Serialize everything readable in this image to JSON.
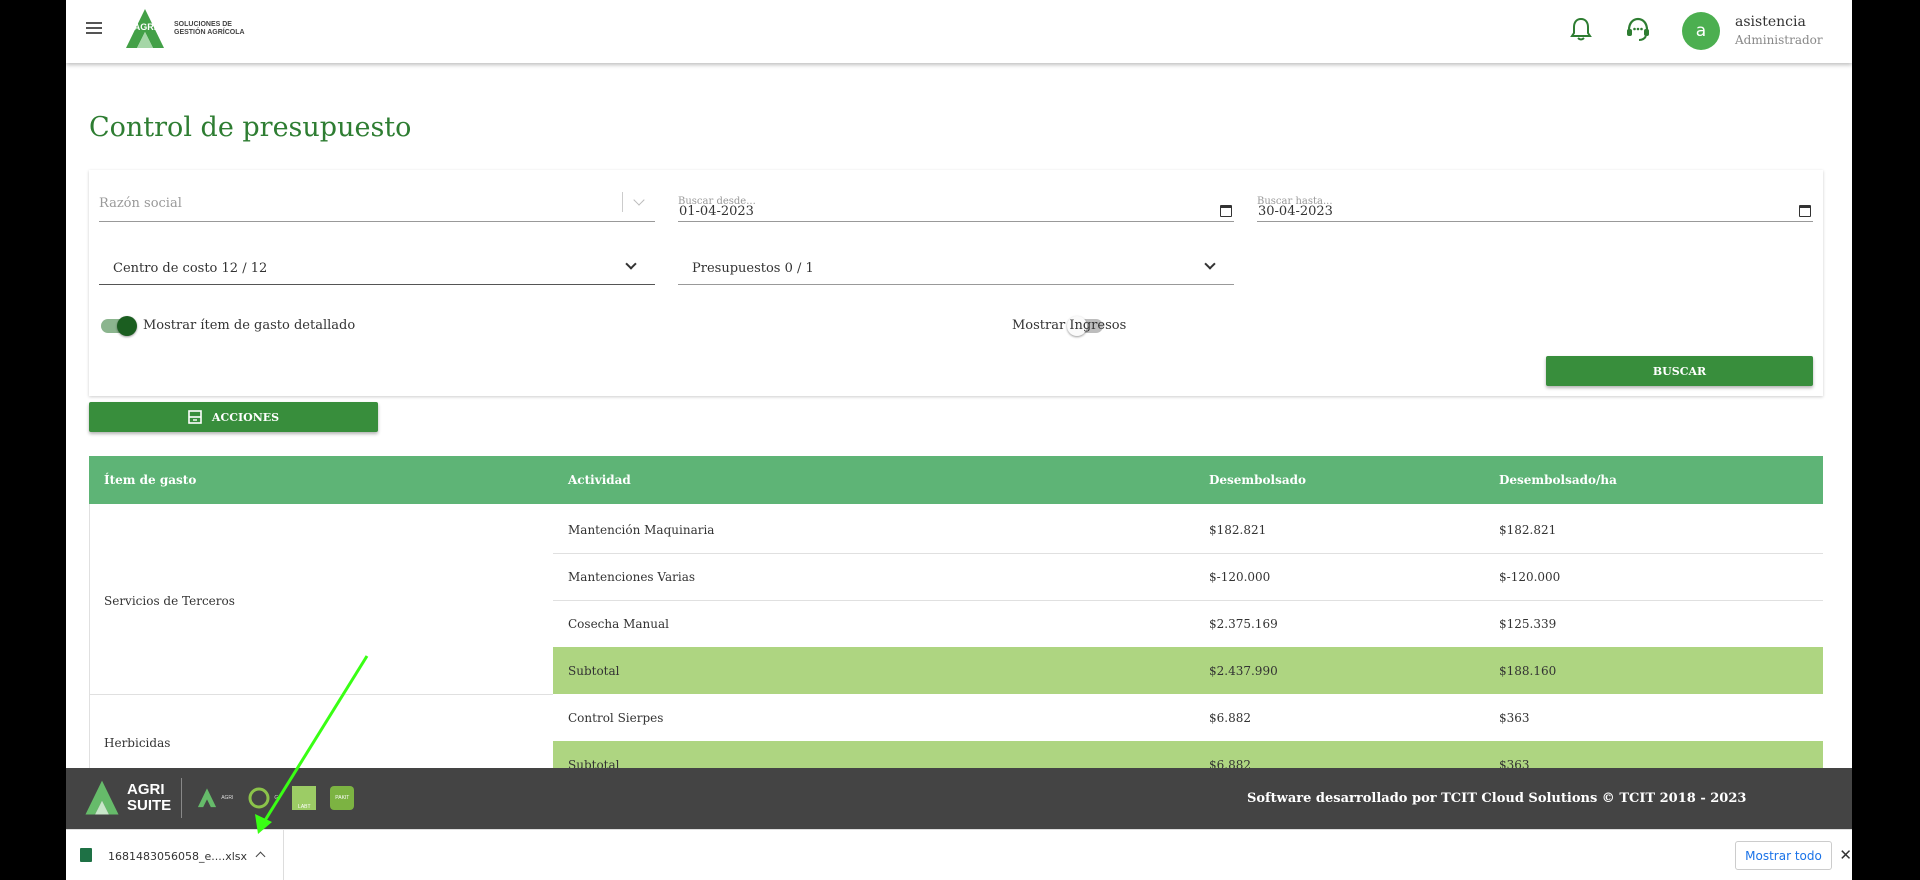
{
  "header": {
    "logo_mark": "AGRI",
    "logo_line1": "SOLUCIONES DE",
    "logo_line2": "GESTIÓN AGRÍCOLA",
    "avatar_letter": "a",
    "user_name": "asistencia",
    "user_role": "Administrador"
  },
  "page": {
    "title": "Control de presupuesto"
  },
  "filters": {
    "razon_social_placeholder": "Razón social",
    "desde_label": "Buscar desde...",
    "desde_value": "01-04-2023",
    "hasta_label": "Buscar hasta...",
    "hasta_value": "30-04-2023",
    "centro_costo": "Centro de costo 12 / 12",
    "presupuestos": "Presupuestos 0 / 1",
    "toggle_detalle_label": "Mostrar ítem de gasto detallado",
    "toggle_detalle_on": true,
    "toggle_ingresos_label": "Mostrar Ingresos",
    "toggle_ingresos_on": false,
    "buscar_label": "BUSCAR",
    "acciones_label": "ACCIONES"
  },
  "table": {
    "headers": [
      "Ítem de gasto",
      "Actividad",
      "Desembolsado",
      "Desembolsado/ha"
    ],
    "groups": [
      {
        "item": "Servicios de Terceros",
        "rows": [
          {
            "actividad": "Mantención Maquinaria",
            "desembolsado": "$182.821",
            "por_ha": "$182.821"
          },
          {
            "actividad": "Mantenciones Varias",
            "desembolsado": "$-120.000",
            "por_ha": "$-120.000"
          },
          {
            "actividad": "Cosecha Manual",
            "desembolsado": "$2.375.169",
            "por_ha": "$125.339"
          }
        ],
        "subtotal": {
          "label": "Subtotal",
          "desembolsado": "$2.437.990",
          "por_ha": "$188.160"
        }
      },
      {
        "item": "Herbicidas",
        "rows": [
          {
            "actividad": "Control Sierpes",
            "desembolsado": "$6.882",
            "por_ha": "$363"
          }
        ],
        "subtotal": {
          "label": "Subtotal",
          "desembolsado": "$6.882",
          "por_ha": "$363"
        }
      }
    ]
  },
  "footer": {
    "brand_main": "AGRI",
    "brand_sub": "SUITE",
    "mini_logos": [
      "AGRI",
      "G",
      "LABT",
      "PAKIT"
    ],
    "credit": "Software desarrollado por TCIT Cloud Solutions © TCIT 2018 - 2023"
  },
  "download_bar": {
    "file_name": "1681483056058_e....xlsx",
    "show_all_label": "Mostrar todo",
    "close_glyph": "✕"
  },
  "colors": {
    "primary": "#388e3c",
    "table_header": "#5eb476",
    "subtotal_row": "#aed581",
    "annotation_arrow": "#39ff14"
  }
}
